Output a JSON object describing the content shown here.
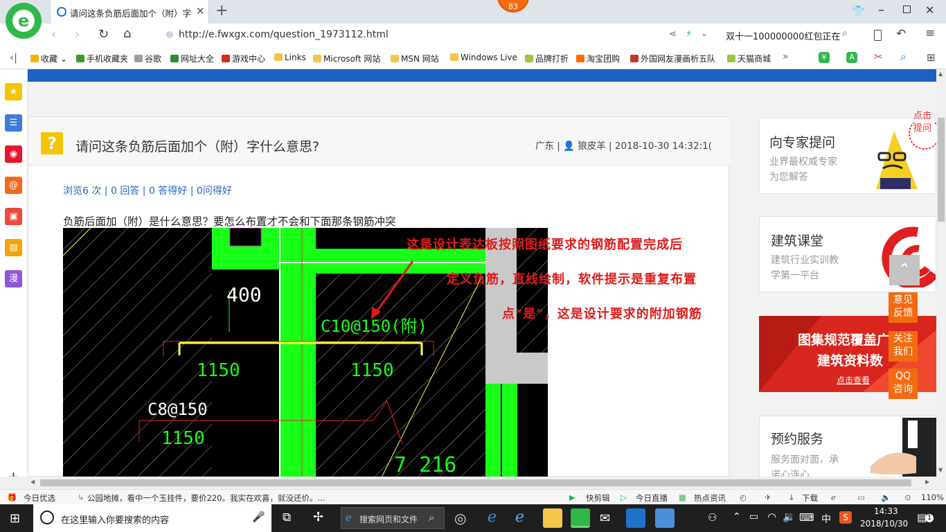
{
  "browser": {
    "tab_title": "请问这条负筋后面加个（附）字什",
    "url": "http://e.fwxgx.com/question_1973112.html",
    "search_text": "双十一100000000红包正在",
    "badge": "83"
  },
  "bookmarks": [
    {
      "label": "收藏",
      "color": "#f5b400"
    },
    {
      "label": "手机收藏夹",
      "color": "#3a9d23"
    },
    {
      "label": "谷歌",
      "color": "#9e9e9e"
    },
    {
      "label": "网址大全",
      "color": "#2e8b2e"
    },
    {
      "label": "游戏中心",
      "color": "#d6271e"
    },
    {
      "label": "Links",
      "color": "#f3c74a"
    },
    {
      "label": "Microsoft 网站",
      "color": "#f3c74a"
    },
    {
      "label": "MSN 网站",
      "color": "#f3c74a"
    },
    {
      "label": "Windows Live",
      "color": "#f3c74a"
    },
    {
      "label": "品牌打折",
      "color": "#9bc53d"
    },
    {
      "label": "淘宝团购",
      "color": "#ff6a00"
    },
    {
      "label": "外国网友漫画析五队",
      "color": "#c0392b"
    },
    {
      "label": "天猫商城",
      "color": "#9bc53d"
    }
  ],
  "sidebar_left": [
    {
      "name": "favorites",
      "color": "#f5c400",
      "glyph": "★"
    },
    {
      "name": "apps",
      "color": "#3b7dd8",
      "glyph": "☰"
    },
    {
      "name": "weibo",
      "color": "#e6162d",
      "glyph": "◉"
    },
    {
      "name": "mail",
      "color": "#f26a21",
      "glyph": "@"
    },
    {
      "name": "game",
      "color": "#e84c3d",
      "glyph": "▣"
    },
    {
      "name": "novel",
      "color": "#f0a30a",
      "glyph": "▤"
    },
    {
      "name": "comic",
      "color": "#8e57d6",
      "glyph": "漫"
    }
  ],
  "question": {
    "icon": "?",
    "title": "请问这条负筋后面加个（附）字什么意思?",
    "meta_region": "广东",
    "meta_user": "狼皮羊",
    "meta_time": "2018-10-30 14:32:1(",
    "stats": "浏览6 次 | 0 回答 | 0 答得好 | 0问得好",
    "body": "负筋后面加（附）是什么意思？要怎么布置才不会和下面那条钢筋冲突"
  },
  "drawing": {
    "dim_400": "400",
    "label_c10": "C10@150(附)",
    "len_1150_a": "1150",
    "len_1150_b": "1150",
    "label_c8": "C8@150",
    "len_1150_c": "1150",
    "len_7216": "7 216"
  },
  "annotation": {
    "line1": "这是设计表达板按照图纸要求的钢筋配置完成后",
    "line2": "定义负筋，直线绘制，软件提示是重复布置",
    "line3": "点“是”，这是设计要求的附加钢筋"
  },
  "right_cards": {
    "expert_title": "向专家提问",
    "expert_sub1": "业界最权威专家",
    "expert_sub2": "为您解答",
    "expert_bubble": "点击提问",
    "class_title": "建筑课堂",
    "class_sub1": "建筑行业实训教",
    "class_sub2": "学第一平台",
    "banner_line1": "图集规范覆盖广",
    "banner_line2": "建筑资料数",
    "banner_btn": "点击查看",
    "service_title": "预约服务",
    "service_sub1": "服务面对面，承",
    "service_sub2": "诺心连心"
  },
  "float_buttons": {
    "feedback": "意见反馈",
    "follow": "关注我们",
    "qq": "QQ咨询"
  },
  "statusbar": {
    "today": "今日优选",
    "news": "公园地摊，看中一个玉挂件，要价220。我实在欢喜，就没还价。...",
    "clip": "快剪辑",
    "live": "今日直播",
    "hot": "热点资讯",
    "download": "下载",
    "zoom": "110%"
  },
  "taskbar": {
    "search_placeholder": "在这里输入你要搜索的内容",
    "web_search": "搜索网页和文件",
    "ime": "中",
    "time": "14:33",
    "date": "2018/10/30",
    "notif": "1"
  }
}
